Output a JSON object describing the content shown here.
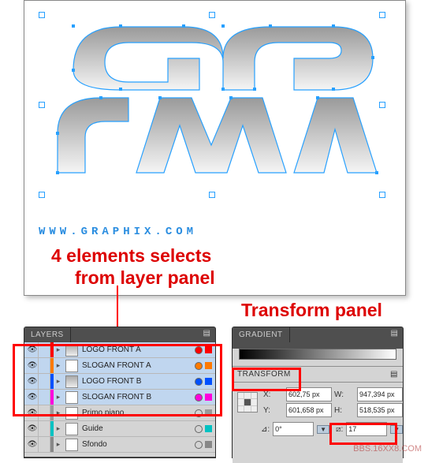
{
  "annotations": {
    "note1": "4 elements selects",
    "note2": "from layer panel",
    "note3": "Transform panel"
  },
  "artboard": {
    "subtext": "WWW.GRAPHIX.COM"
  },
  "layers_panel": {
    "title": "LAYERS",
    "items": [
      {
        "name": "LOGO FRONT A",
        "color": "#ff0000",
        "selected": true,
        "thumb": true
      },
      {
        "name": "SLOGAN FRONT A",
        "color": "#ff7a00",
        "selected": true,
        "thumb": false
      },
      {
        "name": "LOGO FRONT B",
        "color": "#0050ff",
        "selected": true,
        "thumb": true
      },
      {
        "name": "SLOGAN FRONT B",
        "color": "#ff00dd",
        "selected": true,
        "thumb": false
      },
      {
        "name": "Primo piano",
        "color": "#9a9a9a",
        "selected": false,
        "thumb": false
      },
      {
        "name": "Guide",
        "color": "#00c2c2",
        "selected": false,
        "thumb": false
      },
      {
        "name": "Sfondo",
        "color": "#888888",
        "selected": false,
        "thumb": false
      }
    ]
  },
  "right_panel": {
    "gradient_title": "GRADIENT",
    "transform_title": "TRANSFORM",
    "x_label": "X:",
    "y_label": "Y:",
    "w_label": "W:",
    "h_label": "H:",
    "x": "602,75 px",
    "y": "601,658 px",
    "w": "947,394 px",
    "h": "518,535 px",
    "angle_label": "⊿:",
    "angle": "0°",
    "shear_label": "⧄:",
    "shear": "17"
  },
  "watermark": "BBS.16XX8.COM"
}
